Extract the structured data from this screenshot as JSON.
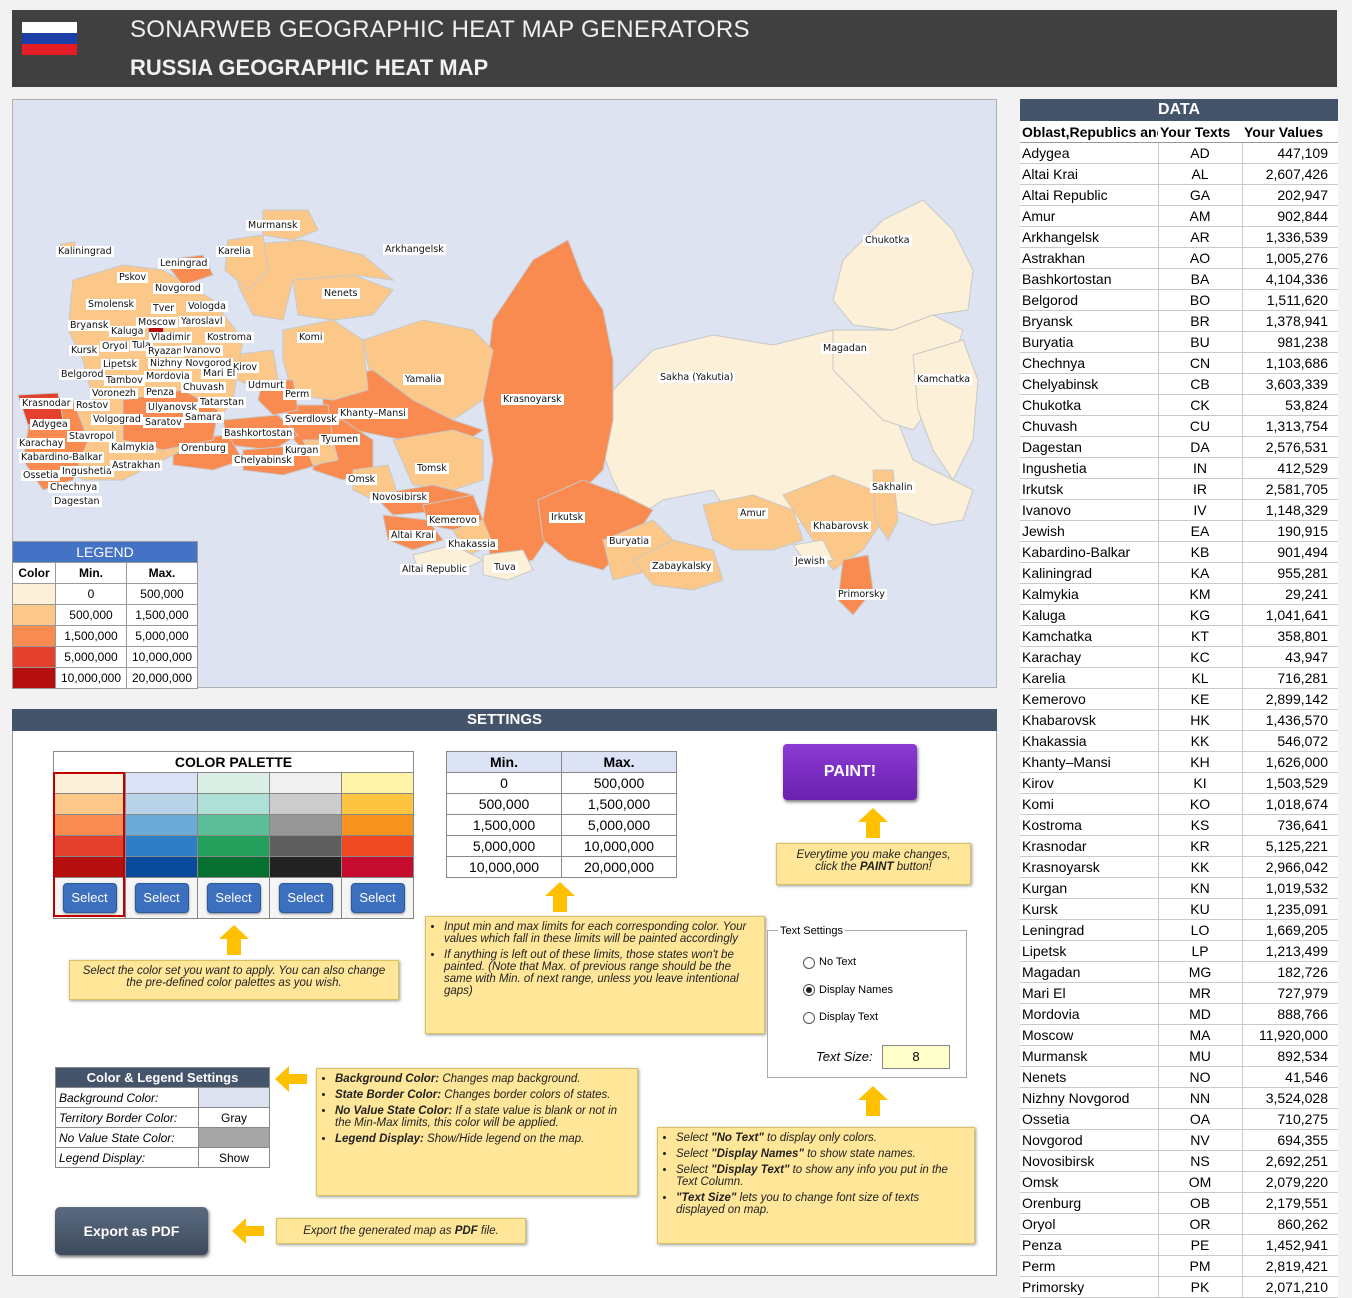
{
  "header": {
    "title_top": "SONARWEB GEOGRAPHIC HEAT MAP GENERATORS",
    "title_main": "RUSSIA GEOGRAPHIC HEAT MAP",
    "flag_colors": [
      "#ffffff",
      "#1c3fa8",
      "#e31c25"
    ]
  },
  "map": {
    "background": "#dde3f1",
    "labels": [
      "Murmansk",
      "Kaliningrad",
      "Leningrad",
      "Karelia",
      "Arkhangelsk",
      "Pskov",
      "Novgorod",
      "Nenets",
      "Smolensk",
      "Vologda",
      "Chukotka",
      "Tver",
      "Yaroslavl",
      "Bryansk",
      "Kaluga",
      "Moscow",
      "Komi",
      "Vladimir",
      "Kostroma",
      "Kursk",
      "Oryol",
      "Tula",
      "Ryazan",
      "Ivanovo",
      "Magadan",
      "Lipetsk",
      "Nizhny Novgorod",
      "Kirov",
      "Belgorod",
      "Tambov",
      "Mordovia",
      "Mari El",
      "Yamalia",
      "Sakha (Yakutia)",
      "Kamchatka",
      "Voronezh",
      "Chuvash",
      "Udmurt",
      "Perm",
      "Krasnoyarsk",
      "Krasnodar",
      "Ulyanovsk",
      "Penza",
      "Tatarstan",
      "Rostov",
      "Khanty–Mansi",
      "Adygea",
      "Volgograd",
      "Saratov",
      "Samara",
      "Sverdlovsk",
      "Stavropol",
      "Bashkortostan",
      "Tyumen",
      "Karachay",
      "Kalmykia",
      "Orenburg",
      "Kurgan",
      "Kabardino-Balkar",
      "Chelyabinsk",
      "Ingushetia",
      "Astrakhan",
      "Tomsk",
      "Ossetia",
      "Omsk",
      "Chechnya",
      "Novosibirsk",
      "Sakhalin",
      "Dagestan",
      "Kemerovo",
      "Irkutsk",
      "Amur",
      "Khabarovsk",
      "Altai Krai",
      "Khakassia",
      "Buryatia",
      "Jewish",
      "Altai Republic",
      "Tuva",
      "Zabaykalsky",
      "Primorsky"
    ]
  },
  "legend": {
    "title": "LEGEND",
    "headers": [
      "Color",
      "Min.",
      "Max."
    ],
    "rows": [
      {
        "color": "#fdf0d8",
        "min": "0",
        "max": "500,000"
      },
      {
        "color": "#fcc889",
        "min": "500,000",
        "max": "1,500,000"
      },
      {
        "color": "#f98a50",
        "min": "1,500,000",
        "max": "5,000,000"
      },
      {
        "color": "#e3402e",
        "min": "5,000,000",
        "max": "10,000,000"
      },
      {
        "color": "#b50f10",
        "min": "10,000,000",
        "max": "20,000,000"
      }
    ]
  },
  "data_table": {
    "title": "DATA",
    "headers": [
      "Oblast,Republics and Krais",
      "Your Texts",
      "Your Values"
    ],
    "rows": [
      [
        "Adygea",
        "AD",
        "447,109"
      ],
      [
        "Altai Krai",
        "AL",
        "2,607,426"
      ],
      [
        "Altai Republic",
        "GA",
        "202,947"
      ],
      [
        "Amur",
        "AM",
        "902,844"
      ],
      [
        "Arkhangelsk",
        "AR",
        "1,336,539"
      ],
      [
        "Astrakhan",
        "AO",
        "1,005,276"
      ],
      [
        "Bashkortostan",
        "BA",
        "4,104,336"
      ],
      [
        "Belgorod",
        "BO",
        "1,511,620"
      ],
      [
        "Bryansk",
        "BR",
        "1,378,941"
      ],
      [
        "Buryatia",
        "BU",
        "981,238"
      ],
      [
        "Chechnya",
        "CN",
        "1,103,686"
      ],
      [
        "Chelyabinsk",
        "CB",
        "3,603,339"
      ],
      [
        "Chukotka",
        "CK",
        "53,824"
      ],
      [
        "Chuvash",
        "CU",
        "1,313,754"
      ],
      [
        "Dagestan",
        "DA",
        "2,576,531"
      ],
      [
        "Ingushetia",
        "IN",
        "412,529"
      ],
      [
        "Irkutsk",
        "IR",
        "2,581,705"
      ],
      [
        "Ivanovo",
        "IV",
        "1,148,329"
      ],
      [
        "Jewish",
        "EA",
        "190,915"
      ],
      [
        "Kabardino-Balkar",
        "KB",
        "901,494"
      ],
      [
        "Kaliningrad",
        "KA",
        "955,281"
      ],
      [
        "Kalmykia",
        "KM",
        "29,241"
      ],
      [
        "Kaluga",
        "KG",
        "1,041,641"
      ],
      [
        "Kamchatka",
        "KT",
        "358,801"
      ],
      [
        "Karachay",
        "KC",
        "43,947"
      ],
      [
        "Karelia",
        "KL",
        "716,281"
      ],
      [
        "Kemerovo",
        "KE",
        "2,899,142"
      ],
      [
        "Khabarovsk",
        "HK",
        "1,436,570"
      ],
      [
        "Khakassia",
        "KK",
        "546,072"
      ],
      [
        "Khanty–Mansi",
        "KH",
        "1,626,000"
      ],
      [
        "Kirov",
        "KI",
        "1,503,529"
      ],
      [
        "Komi",
        "KO",
        "1,018,674"
      ],
      [
        "Kostroma",
        "KS",
        "736,641"
      ],
      [
        "Krasnodar",
        "KR",
        "5,125,221"
      ],
      [
        "Krasnoyarsk",
        "KK",
        "2,966,042"
      ],
      [
        "Kurgan",
        "KN",
        "1,019,532"
      ],
      [
        "Kursk",
        "KU",
        "1,235,091"
      ],
      [
        "Leningrad",
        "LO",
        "1,669,205"
      ],
      [
        "Lipetsk",
        "LP",
        "1,213,499"
      ],
      [
        "Magadan",
        "MG",
        "182,726"
      ],
      [
        "Mari El",
        "MR",
        "727,979"
      ],
      [
        "Mordovia",
        "MD",
        "888,766"
      ],
      [
        "Moscow",
        "MA",
        "11,920,000"
      ],
      [
        "Murmansk",
        "MU",
        "892,534"
      ],
      [
        "Nenets",
        "NO",
        "41,546"
      ],
      [
        "Nizhny Novgorod",
        "NN",
        "3,524,028"
      ],
      [
        "Ossetia",
        "OA",
        "710,275"
      ],
      [
        "Novgorod",
        "NV",
        "694,355"
      ],
      [
        "Novosibirsk",
        "NS",
        "2,692,251"
      ],
      [
        "Omsk",
        "OM",
        "2,079,220"
      ],
      [
        "Orenburg",
        "OB",
        "2,179,551"
      ],
      [
        "Oryol",
        "OR",
        "860,262"
      ],
      [
        "Penza",
        "PE",
        "1,452,941"
      ],
      [
        "Perm",
        "PM",
        "2,819,421"
      ],
      [
        "Primorsky",
        "PK",
        "2,071,210"
      ]
    ]
  },
  "settings": {
    "title": "SETTINGS",
    "palette_title": "COLOR PALETTE",
    "palette_columns": [
      [
        "#fdf0d8",
        "#fcc889",
        "#f98a50",
        "#e3402e",
        "#b50f10"
      ],
      [
        "#dde3f6",
        "#b8d3e8",
        "#6aabd8",
        "#2f7dc4",
        "#0a4a9c"
      ],
      [
        "#dcefe6",
        "#aee0d8",
        "#5dbf9a",
        "#25a05c",
        "#067030"
      ],
      [
        "#f0f0f0",
        "#cccccc",
        "#969696",
        "#5f5f5f",
        "#222222"
      ],
      [
        "#fff3a8",
        "#fdc441",
        "#f7931e",
        "#f04a23",
        "#c50b2e"
      ]
    ],
    "select_label": "Select",
    "palette_note": "Select the color set you want to apply. You can also change the pre-defined color palettes as you wish.",
    "limits_headers": [
      "Min.",
      "Max."
    ],
    "limits": [
      [
        "0",
        "500,000"
      ],
      [
        "500,000",
        "1,500,000"
      ],
      [
        "1,500,000",
        "5,000,000"
      ],
      [
        "5,000,000",
        "10,000,000"
      ],
      [
        "10,000,000",
        "20,000,000"
      ]
    ],
    "limits_note_1": "Input min and max limits for each corresponding color. Your values which fall in these limits will be painted accordingly",
    "limits_note_2": "If anything is left out of these limits, those states won't be painted. (Note that Max. of previous range should be the same with Min. of next range, unless you leave intentional gaps)",
    "paint_label": "PAINT!",
    "paint_note_1": "Everytime you make changes,",
    "paint_note_2a": "click the ",
    "paint_note_2b": "PAINT",
    "paint_note_2c": " button!",
    "text_settings": {
      "title": "Text Settings",
      "options": [
        "No Text",
        "Display Names",
        "Display Text"
      ],
      "selected": 1,
      "size_label": "Text Size:",
      "size_value": "8"
    },
    "text_note": [
      {
        "a": "Select ",
        "b": "\"No Text\"",
        "c": " to display only colors."
      },
      {
        "a": "Select ",
        "b": "\"Display Names\"",
        "c": " to show state names."
      },
      {
        "a": "Select ",
        "b": "\"Display Text\"",
        "c": " to show any info you put in the Text Column."
      },
      {
        "a": "",
        "b": "\"Text Size\"",
        "c": " lets you to change font size of texts displayed on map."
      }
    ],
    "color_legend": {
      "title": "Color & Legend Settings",
      "rows": [
        {
          "key": "Background Color:",
          "value": "",
          "swatch": "#dde3f1"
        },
        {
          "key": "Territory Border Color:",
          "value": "Gray",
          "swatch": ""
        },
        {
          "key": "No Value State Color:",
          "value": "",
          "swatch": "#a6a6a6"
        },
        {
          "key": "Legend Display:",
          "value": "Show",
          "swatch": ""
        }
      ]
    },
    "color_note": [
      {
        "b": "Background Color:",
        "c": " Changes map background."
      },
      {
        "b": "State Border Color:",
        "c": " Changes border colors of states."
      },
      {
        "b": "No Value State Color:",
        "c": " If a state value is blank or not in the Min-Max limits, this color will be applied."
      },
      {
        "b": "Legend Display:",
        "c": " Show/Hide legend on the map."
      }
    ],
    "export_label": "Export as PDF",
    "export_note_a": "Export the generated map as ",
    "export_note_b": "PDF",
    "export_note_c": " file."
  }
}
